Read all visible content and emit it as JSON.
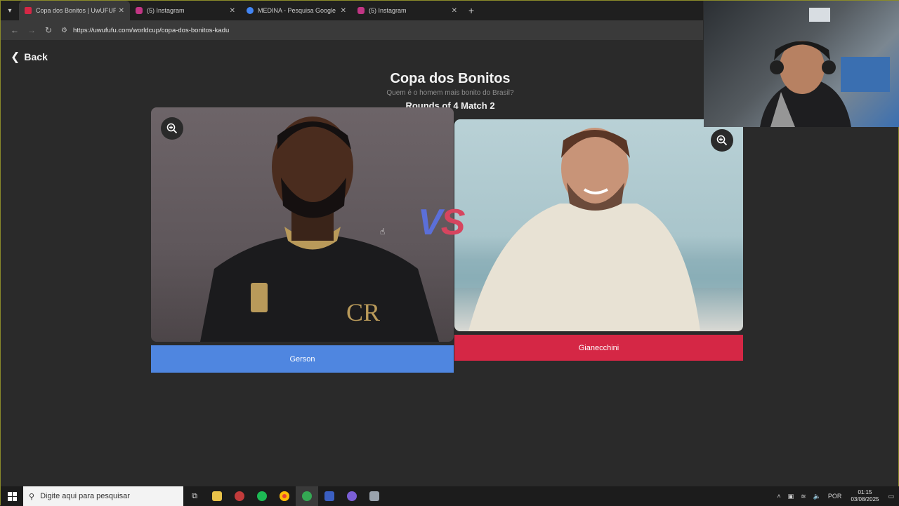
{
  "browser": {
    "tabs": [
      {
        "title": "Copa dos Bonitos | UwUFUFU",
        "active": true,
        "favicon_color": "#d52745"
      },
      {
        "title": "(5) Instagram",
        "active": false,
        "favicon_color": "#c13584"
      },
      {
        "title": "MEDINA - Pesquisa Google",
        "active": false,
        "favicon_color": "#4285f4"
      },
      {
        "title": "(5) Instagram",
        "active": false,
        "favicon_color": "#c13584"
      }
    ],
    "url": "https://uwufufu.com/worldcup/copa-dos-bonitos-kadu"
  },
  "page": {
    "back_label": "Back",
    "title": "Copa dos Bonitos",
    "subtitle": "Quem é o homem mais bonito do Brasil?",
    "round": "Rounds of 4 Match 2",
    "vs_v": "V",
    "vs_s": "S",
    "left_choice": "Gerson",
    "right_choice": "Gianecchini"
  },
  "taskbar": {
    "search_placeholder": "Digite aqui para pesquisar",
    "language": "POR",
    "time": "01:15",
    "date": "03/08/2025"
  },
  "colors": {
    "left_button": "#4f86e0",
    "right_button": "#d52745"
  }
}
